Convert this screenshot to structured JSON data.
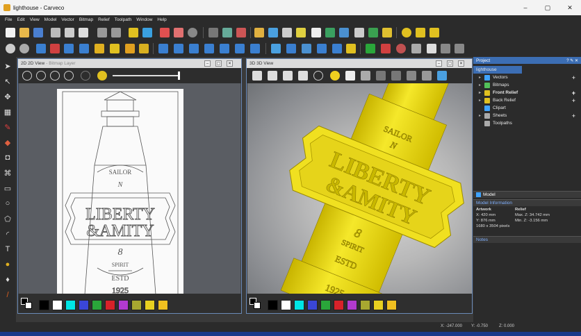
{
  "window": {
    "title": "lighthouse - Carveco",
    "min": "–",
    "max": "▢",
    "close": "✕"
  },
  "menu": [
    "File",
    "Edit",
    "View",
    "Model",
    "Vector",
    "Bitmap",
    "Relief",
    "Toolpath",
    "Window",
    "Help"
  ],
  "view2d": {
    "title": "2D",
    "title_full": "2D View",
    "subtitle": "- Bitmap Layer"
  },
  "view3d": {
    "title": "3D",
    "title_full": "3D View"
  },
  "artwork": {
    "top_arc": "SAILOR",
    "letter": "N",
    "line1": "LIBERTY",
    "line2": "&AMITY",
    "bottom_arc": "SPIRIT",
    "est": "ESTD",
    "year": "1925",
    "figure8": "8"
  },
  "palette_colors": [
    "#000000",
    "#ffffff",
    "#00e5e5",
    "#3a46d8",
    "#2aa63a",
    "#d8222a",
    "#b23ad0",
    "#a8a830",
    "#e8d020",
    "#f0c020"
  ],
  "project": {
    "header": "Project",
    "root": "lighthouse",
    "items": [
      {
        "label": "Vectors",
        "bold": false,
        "color": "#3fa3ff"
      },
      {
        "label": "Bitmaps",
        "bold": false,
        "color": "#52c15a"
      },
      {
        "label": "Front Relief",
        "bold": true,
        "color": "#e0c020"
      },
      {
        "label": "Back Relief",
        "bold": false,
        "color": "#e0c020"
      },
      {
        "label": "Clipart",
        "bold": false,
        "color": "#3fa3ff"
      },
      {
        "label": "Sheets",
        "bold": false,
        "color": "#aaaaaa"
      },
      {
        "label": "Toolpaths",
        "bold": false,
        "color": "#aaaaaa"
      }
    ]
  },
  "model": {
    "header": "Model",
    "info_header": "Model Information",
    "artwork_label": "Artwork",
    "relief_label": "Relief",
    "x": "X: 420 mm",
    "y": "Y: 876 mm",
    "pixels": "1680 x 3504 pixels",
    "maxz": "Max. Z: 34.742 mm",
    "minz": "Min. Z: -3.156 mm",
    "notes": "Notes"
  },
  "status": {
    "x": "X: -247.000",
    "y": "Y: -0.750",
    "z": "Z: 0.000"
  }
}
